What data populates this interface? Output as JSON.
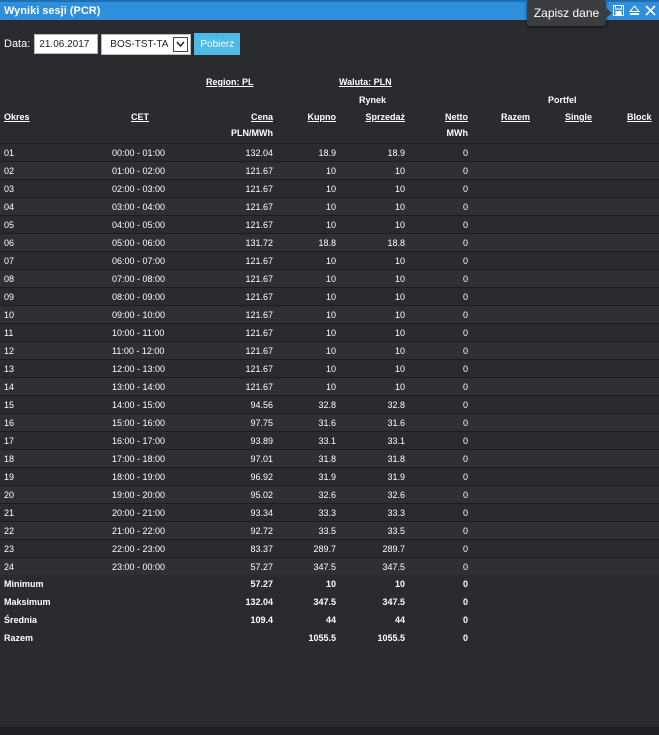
{
  "window": {
    "title": "Wyniki sesji (PCR)",
    "tooltip": "Zapisz dane"
  },
  "toolbar": {
    "date_label": "Data:",
    "date_value": "21.06.2017",
    "select_value": "BOS-TST-TA",
    "button_label": "Pobierz"
  },
  "headers": {
    "region": "Region: PL",
    "waluta": "Waluta: PLN",
    "rynek": "Rynek",
    "portfel": "Portfel",
    "okres": "Okres",
    "cet": "CET",
    "cena": "Cena",
    "kupno": "Kupno",
    "sprzedaz": "Sprzedaż",
    "netto": "Netto",
    "razem": "Razem",
    "single": "Single",
    "block": "Block",
    "unit_price": "PLN/MWh",
    "unit_mwh": "MWh"
  },
  "rows": [
    {
      "okres": "01",
      "cet": "00:00 - 01:00",
      "cena": "132.04",
      "kupno": "18.9",
      "sprzedaz": "18.9",
      "netto": "0"
    },
    {
      "okres": "02",
      "cet": "01:00 - 02:00",
      "cena": "121.67",
      "kupno": "10",
      "sprzedaz": "10",
      "netto": "0"
    },
    {
      "okres": "03",
      "cet": "02:00 - 03:00",
      "cena": "121.67",
      "kupno": "10",
      "sprzedaz": "10",
      "netto": "0"
    },
    {
      "okres": "04",
      "cet": "03:00 - 04:00",
      "cena": "121.67",
      "kupno": "10",
      "sprzedaz": "10",
      "netto": "0"
    },
    {
      "okres": "05",
      "cet": "04:00 - 05:00",
      "cena": "121.67",
      "kupno": "10",
      "sprzedaz": "10",
      "netto": "0"
    },
    {
      "okres": "06",
      "cet": "05:00 - 06:00",
      "cena": "131.72",
      "kupno": "18.8",
      "sprzedaz": "18.8",
      "netto": "0"
    },
    {
      "okres": "07",
      "cet": "06:00 - 07:00",
      "cena": "121.67",
      "kupno": "10",
      "sprzedaz": "10",
      "netto": "0"
    },
    {
      "okres": "08",
      "cet": "07:00 - 08:00",
      "cena": "121.67",
      "kupno": "10",
      "sprzedaz": "10",
      "netto": "0"
    },
    {
      "okres": "09",
      "cet": "08:00 - 09:00",
      "cena": "121.67",
      "kupno": "10",
      "sprzedaz": "10",
      "netto": "0"
    },
    {
      "okres": "10",
      "cet": "09:00 - 10:00",
      "cena": "121.67",
      "kupno": "10",
      "sprzedaz": "10",
      "netto": "0"
    },
    {
      "okres": "11",
      "cet": "10:00 - 11:00",
      "cena": "121.67",
      "kupno": "10",
      "sprzedaz": "10",
      "netto": "0"
    },
    {
      "okres": "12",
      "cet": "11:00 - 12:00",
      "cena": "121.67",
      "kupno": "10",
      "sprzedaz": "10",
      "netto": "0"
    },
    {
      "okres": "13",
      "cet": "12:00 - 13:00",
      "cena": "121.67",
      "kupno": "10",
      "sprzedaz": "10",
      "netto": "0"
    },
    {
      "okres": "14",
      "cet": "13:00 - 14:00",
      "cena": "121.67",
      "kupno": "10",
      "sprzedaz": "10",
      "netto": "0"
    },
    {
      "okres": "15",
      "cet": "14:00 - 15:00",
      "cena": "94.56",
      "kupno": "32.8",
      "sprzedaz": "32.8",
      "netto": "0"
    },
    {
      "okres": "16",
      "cet": "15:00 - 16:00",
      "cena": "97.75",
      "kupno": "31.6",
      "sprzedaz": "31.6",
      "netto": "0"
    },
    {
      "okres": "17",
      "cet": "16:00 - 17:00",
      "cena": "93.89",
      "kupno": "33.1",
      "sprzedaz": "33.1",
      "netto": "0"
    },
    {
      "okres": "18",
      "cet": "17:00 - 18:00",
      "cena": "97.01",
      "kupno": "31.8",
      "sprzedaz": "31.8",
      "netto": "0"
    },
    {
      "okres": "19",
      "cet": "18:00 - 19:00",
      "cena": "96.92",
      "kupno": "31.9",
      "sprzedaz": "31.9",
      "netto": "0"
    },
    {
      "okres": "20",
      "cet": "19:00 - 20:00",
      "cena": "95.02",
      "kupno": "32.6",
      "sprzedaz": "32.6",
      "netto": "0"
    },
    {
      "okres": "21",
      "cet": "20:00 - 21:00",
      "cena": "93.34",
      "kupno": "33.3",
      "sprzedaz": "33.3",
      "netto": "0"
    },
    {
      "okres": "22",
      "cet": "21:00 - 22:00",
      "cena": "92.72",
      "kupno": "33.5",
      "sprzedaz": "33.5",
      "netto": "0"
    },
    {
      "okres": "23",
      "cet": "22:00 - 23:00",
      "cena": "83.37",
      "kupno": "289.7",
      "sprzedaz": "289.7",
      "netto": "0"
    },
    {
      "okres": "24",
      "cet": "23:00 - 00:00",
      "cena": "57.27",
      "kupno": "347.5",
      "sprzedaz": "347.5",
      "netto": "0"
    }
  ],
  "summary": [
    {
      "label": "Minimum",
      "cena": "57.27",
      "kupno": "10",
      "sprzedaz": "10",
      "netto": "0"
    },
    {
      "label": "Maksimum",
      "cena": "132.04",
      "kupno": "347.5",
      "sprzedaz": "347.5",
      "netto": "0"
    },
    {
      "label": "Średnia",
      "cena": "109.4",
      "kupno": "44",
      "sprzedaz": "44",
      "netto": "0"
    },
    {
      "label": "Razem",
      "cena": "",
      "kupno": "1055.5",
      "sprzedaz": "1055.5",
      "netto": "0"
    }
  ]
}
